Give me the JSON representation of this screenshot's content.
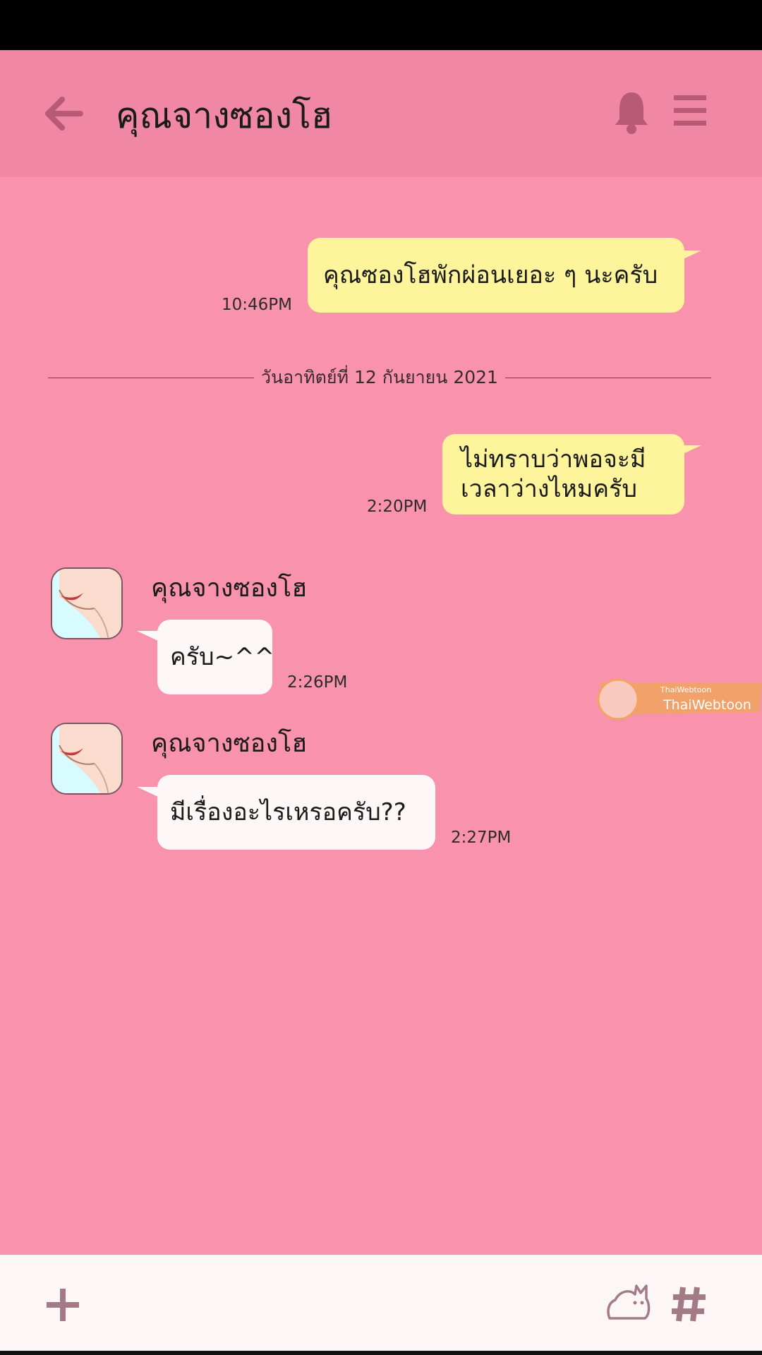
{
  "header": {
    "title": "คุณจางซองโฮ",
    "back_icon": "arrow-left-icon",
    "bell_icon": "bell-icon",
    "menu_icon": "hamburger-menu-icon"
  },
  "messages": [
    {
      "direction": "out",
      "text": "คุณซองโฮพักผ่อนเยอะ ๆ นะครับ",
      "time": "10:46PM"
    },
    {
      "direction": "out",
      "lines": [
        "ไม่ทราบว่าพอจะมี",
        "เวลาว่างไหมครับ"
      ],
      "time": "2:20PM"
    },
    {
      "direction": "in",
      "sender": "คุณจางซองโฮ",
      "text": "ครับ~^^",
      "time": "2:26PM"
    },
    {
      "direction": "in",
      "sender": "คุณจางซองโฮ",
      "text": "มีเรื่องอะไรเหรอครับ??",
      "time": "2:27PM"
    }
  ],
  "date_divider": "วันอาทิตย์ที่ 12 กันยายน 2021",
  "input_bar": {
    "plus_icon": "plus-icon",
    "sticker_icon": "sticker-bunny-icon",
    "hash_icon": "hashtag-icon"
  },
  "colors": {
    "header_bg": "#f087a4",
    "chat_bg": "#f892ad",
    "outgoing_bubble": "#fdf49b",
    "incoming_bubble": "#fdf7f8",
    "icon_color": "#b85a75"
  }
}
